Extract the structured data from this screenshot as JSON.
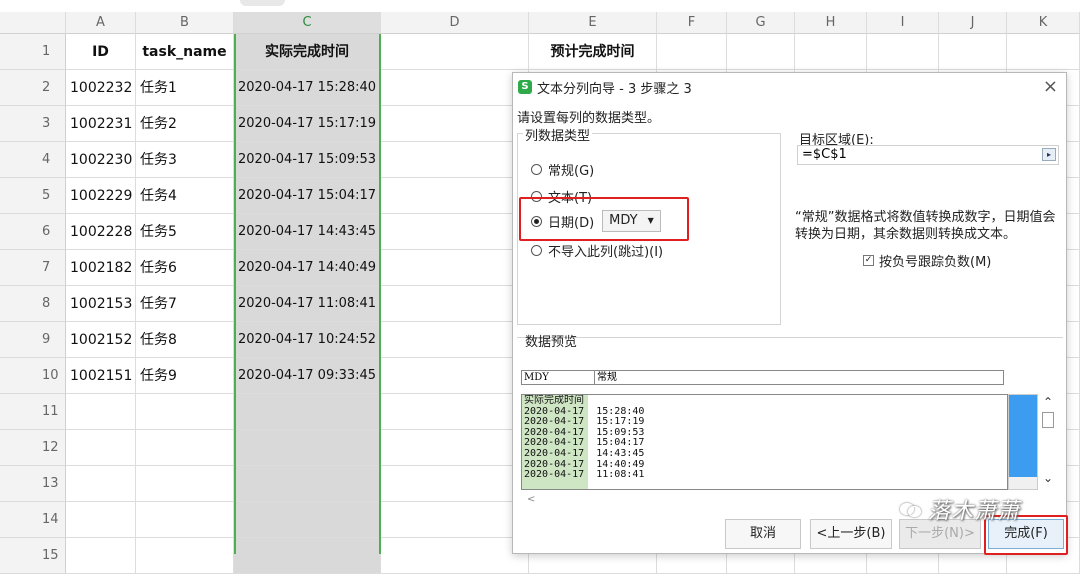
{
  "columns": [
    "A",
    "B",
    "C",
    "D",
    "E",
    "F",
    "G",
    "H",
    "I",
    "J",
    "K"
  ],
  "row_numbers": [
    "1",
    "2",
    "3",
    "4",
    "5",
    "6",
    "7",
    "8",
    "9",
    "10",
    "11",
    "12",
    "13",
    "14",
    "15"
  ],
  "table_header": {
    "id": "ID",
    "task_name": "task_name",
    "actual": "实际完成时间",
    "planned": "预计完成时间"
  },
  "rows": [
    {
      "id": "1002232",
      "task": "任务1",
      "time": "2020-04-17 15:28:40"
    },
    {
      "id": "1002231",
      "task": "任务2",
      "time": "2020-04-17 15:17:19"
    },
    {
      "id": "1002230",
      "task": "任务3",
      "time": "2020-04-17 15:09:53"
    },
    {
      "id": "1002229",
      "task": "任务4",
      "time": "2020-04-17 15:04:17"
    },
    {
      "id": "1002228",
      "task": "任务5",
      "time": "2020-04-17 14:43:45"
    },
    {
      "id": "1002182",
      "task": "任务6",
      "time": "2020-04-17 14:40:49"
    },
    {
      "id": "1002153",
      "task": "任务7",
      "time": "2020-04-17 11:08:41"
    },
    {
      "id": "1002152",
      "task": "任务8",
      "time": "2020-04-17 10:24:52"
    },
    {
      "id": "1002151",
      "task": "任务9",
      "time": "2020-04-17 09:33:45"
    }
  ],
  "dialog": {
    "logo": "S",
    "title": "文本分列向导 - 3 步骤之 3",
    "close": "×",
    "prompt": "请设置每列的数据类型。",
    "group_label": "列数据类型",
    "radio_general": "常规(G)",
    "radio_text": "文本(T)",
    "radio_date": "日期(D)",
    "date_format": "MDY",
    "radio_skip": "不导入此列(跳过)(I)",
    "target_label": "目标区域(E):",
    "target_value": "=$C$1",
    "description": "“常规”数据格式将数值转换成数字，日期值会转换为日期，其余数据则转换成文本。",
    "checkbox_label": "按负号跟踪负数(M)",
    "preview_label": "数据预览",
    "preview_head_1": "MDY",
    "preview_head_2": "常规",
    "preview_lines": [
      "实际完成时间",
      "2020-04-17  15:28:40",
      "2020-04-17  15:17:19",
      "2020-04-17  15:09:53",
      "2020-04-17  15:04:17",
      "2020-04-17  14:43:45",
      "2020-04-17  14:40:49",
      "2020-04-17  11:08:41"
    ],
    "btn_cancel": "取消",
    "btn_prev": "<上一步(B)",
    "btn_next": "下一步(N)>",
    "btn_finish": "完成(F)"
  },
  "watermark": "落木萧萧",
  "colors": {
    "accent_green": "#4caf50",
    "highlight_red": "#e02020",
    "selection_gray": "#d9d9d9",
    "preview_scroll": "#3b9cf0"
  }
}
